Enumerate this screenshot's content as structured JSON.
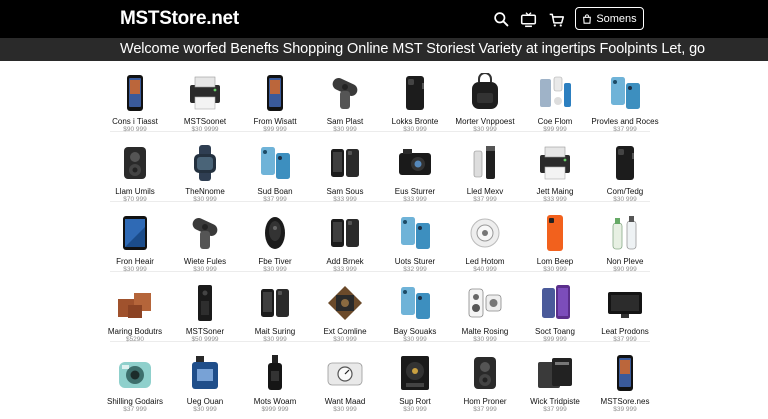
{
  "header": {
    "logo": "MSTStore.net",
    "signin_label": "Somens",
    "icons": [
      "search-icon",
      "tv-icon",
      "cart-icon",
      "bag-icon"
    ]
  },
  "banner": {
    "text": "Welcome worfed Benefts Shopping Online MST Storiest Variety at ingertips Foolpints Let, go"
  },
  "colors": {
    "topbar": "#000000",
    "banner": "#2a2a2a",
    "price": "#8c8c8c"
  },
  "products": [
    {
      "name": "Cons i Tiasst",
      "price": "$90 999",
      "icon": "smartphone-icon"
    },
    {
      "name": "MSTSoonet",
      "price": "$30 9999",
      "icon": "printer-icon"
    },
    {
      "name": "From Wisatt",
      "price": "$99 999",
      "icon": "smartphone-icon"
    },
    {
      "name": "Sam Plast",
      "price": "$30 999",
      "icon": "phone-mount-icon"
    },
    {
      "name": "Lokks Bronte",
      "price": "$30 999",
      "icon": "phone-case-icon"
    },
    {
      "name": "Morter Vnppoest",
      "price": "$30 999",
      "icon": "backpack-icon"
    },
    {
      "name": "Coe Flom",
      "price": "$99 999",
      "icon": "phone-accessories-icon"
    },
    {
      "name": "Provles and Roces",
      "price": "$37 999",
      "icon": "phone-set-icon"
    },
    {
      "name": "Llam Umils",
      "price": "$70 999",
      "icon": "speaker-icon"
    },
    {
      "name": "TheNnome",
      "price": "$30 999",
      "icon": "smartwatch-icon"
    },
    {
      "name": "Sud Boan",
      "price": "$37 999",
      "icon": "phone-set-icon"
    },
    {
      "name": "Sam Sous",
      "price": "$33 999",
      "icon": "dual-phones-icon"
    },
    {
      "name": "Eus Sturrer",
      "price": "$33 999",
      "icon": "camera-phone-icon"
    },
    {
      "name": "Lled Mexv",
      "price": "$37 999",
      "icon": "tumbler-icon"
    },
    {
      "name": "Jett Maing",
      "price": "$33 999",
      "icon": "printer-icon"
    },
    {
      "name": "Com/Tedg",
      "price": "$30 999",
      "icon": "phone-case-icon"
    },
    {
      "name": "Fron Heair",
      "price": "$30 999",
      "icon": "tablet-icon"
    },
    {
      "name": "Wiete Fules",
      "price": "$30 999",
      "icon": "phone-mount-icon"
    },
    {
      "name": "Fbe Tiver",
      "price": "$30 999",
      "icon": "earbud-icon"
    },
    {
      "name": "Add Brnek",
      "price": "$33 999",
      "icon": "dual-phones-icon"
    },
    {
      "name": "Uots Sturer",
      "price": "$32 999",
      "icon": "phone-set-icon"
    },
    {
      "name": "Led Hotom",
      "price": "$40 999",
      "icon": "fan-icon"
    },
    {
      "name": "Lom Beep",
      "price": "$30 999",
      "icon": "orange-phone-icon"
    },
    {
      "name": "Non Pleve",
      "price": "$90 999",
      "icon": "bottles-icon"
    },
    {
      "name": "Maring Bodutrs",
      "price": "$5290",
      "icon": "boxes-icon"
    },
    {
      "name": "MSTSoner",
      "price": "$50 9999",
      "icon": "tower-speaker-icon"
    },
    {
      "name": "Mait Suring",
      "price": "$30 999",
      "icon": "dual-phones-icon"
    },
    {
      "name": "Ext Comline",
      "price": "$30 999",
      "icon": "bronze-device-icon"
    },
    {
      "name": "Bay Souaks",
      "price": "$30 999",
      "icon": "phone-set-icon"
    },
    {
      "name": "Malte Rosing",
      "price": "$30 999",
      "icon": "speaker-set-icon"
    },
    {
      "name": "Soct Toang",
      "price": "$99 999",
      "icon": "purple-phone-icon"
    },
    {
      "name": "Leat Prodons",
      "price": "$37 999",
      "icon": "monitor-icon"
    },
    {
      "name": "Shilling Godairs",
      "price": "$37 999",
      "icon": "instant-camera-icon"
    },
    {
      "name": "Ueg Ouan",
      "price": "$30 999",
      "icon": "perfume-icon"
    },
    {
      "name": "Mots Woam",
      "price": "$999 999",
      "icon": "bottle-icon"
    },
    {
      "name": "Want Maad",
      "price": "$30 999",
      "icon": "scale-icon"
    },
    {
      "name": "Sup Rort",
      "price": "$30 999",
      "icon": "record-player-icon"
    },
    {
      "name": "Hom Proner",
      "price": "$37 999",
      "icon": "speaker-icon"
    },
    {
      "name": "Wick Tridpiste",
      "price": "$37 999",
      "icon": "wallet-icon"
    },
    {
      "name": "MSTSore.nes",
      "price": "$39 999",
      "icon": "smartphone-icon"
    }
  ]
}
